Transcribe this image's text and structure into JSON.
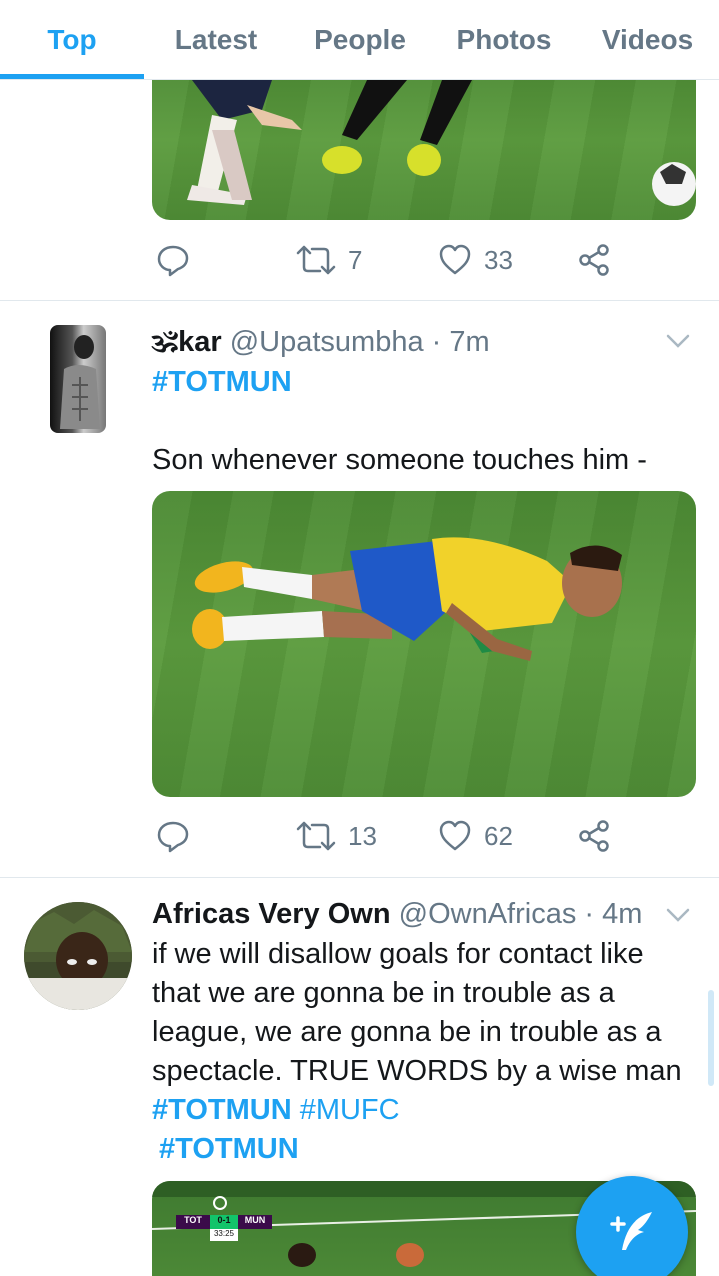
{
  "tabs": [
    {
      "label": "Top",
      "active": true
    },
    {
      "label": "Latest",
      "active": false
    },
    {
      "label": "People",
      "active": false
    },
    {
      "label": "Photos",
      "active": false
    },
    {
      "label": "Videos",
      "active": false
    }
  ],
  "tweets": [
    {
      "actions": {
        "retweets": "7",
        "likes": "33"
      }
    },
    {
      "name": "🕉kar",
      "handle": "@Upatsumbha",
      "time": "7m",
      "hashtag": "#TOTMUN",
      "text": "Son whenever someone touches him -",
      "actions": {
        "retweets": "13",
        "likes": "62"
      }
    },
    {
      "name": "Africas Very Own",
      "handle": "@OwnAfricas",
      "time": "4m",
      "text_lines": [
        "if we will disallow goals for contact like",
        "that we are gonna be in trouble as a",
        "league, we are gonna be in trouble as a",
        "spectacle. TRUE WORDS by a wise man"
      ],
      "hashtags_line": [
        "#TOTMUN",
        "#MUFC"
      ],
      "hashtag_extra": "#TOTMUN",
      "scoreboard": {
        "home": "TOT",
        "score": "0-1",
        "away": "MUN",
        "clock": "33:25"
      }
    }
  ],
  "separator_dot": "·",
  "colors": {
    "accent": "#1da1f2",
    "muted": "#657786",
    "text": "#14171a",
    "divider": "#e1e8ed"
  },
  "icons": [
    "reply-icon",
    "retweet-icon",
    "like-icon",
    "share-icon",
    "caret-down-icon",
    "compose-icon"
  ]
}
